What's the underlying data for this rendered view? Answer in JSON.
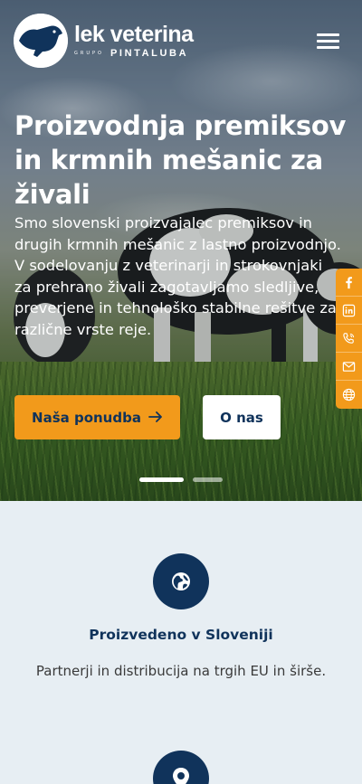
{
  "header": {
    "logo_title": "lek veterina",
    "logo_grupo": "GRUPO",
    "logo_subtitle": "PINTALUBA",
    "menu_icon": "hamburger-menu-icon"
  },
  "hero": {
    "title": "Proizvodnja premiksov in krmnih mešanic za živali",
    "description": "Smo slovenski proizvajalec premiksov in drugih krmnih mešanic z lastno proizvodnjo. V sodelovanju z veterinarji in strokovnjaki za prehrano živali zagotavljamo sledljive, preverjene in tehnološko stabilne rešitve za različne vrste reje.",
    "primary_button": "Naša ponudba",
    "primary_button_icon": "arrow-right-icon",
    "secondary_button": "O nas",
    "slides_total": 2,
    "active_slide": 1
  },
  "social": [
    {
      "icon": "facebook-icon"
    },
    {
      "icon": "linkedin-icon"
    },
    {
      "icon": "phone-icon"
    },
    {
      "icon": "mail-icon"
    },
    {
      "icon": "globe-icon"
    }
  ],
  "features": [
    {
      "icon": "globe-europe-icon",
      "title": "Proizvedeno v Sloveniji",
      "text": "Partnerji in distribucija na trgih EU in širše."
    },
    {
      "icon": "location-pin-icon"
    }
  ],
  "colors": {
    "accent": "#f29a1b",
    "navy": "#10335b",
    "section_bg": "#e7eef3",
    "white": "#ffffff"
  }
}
